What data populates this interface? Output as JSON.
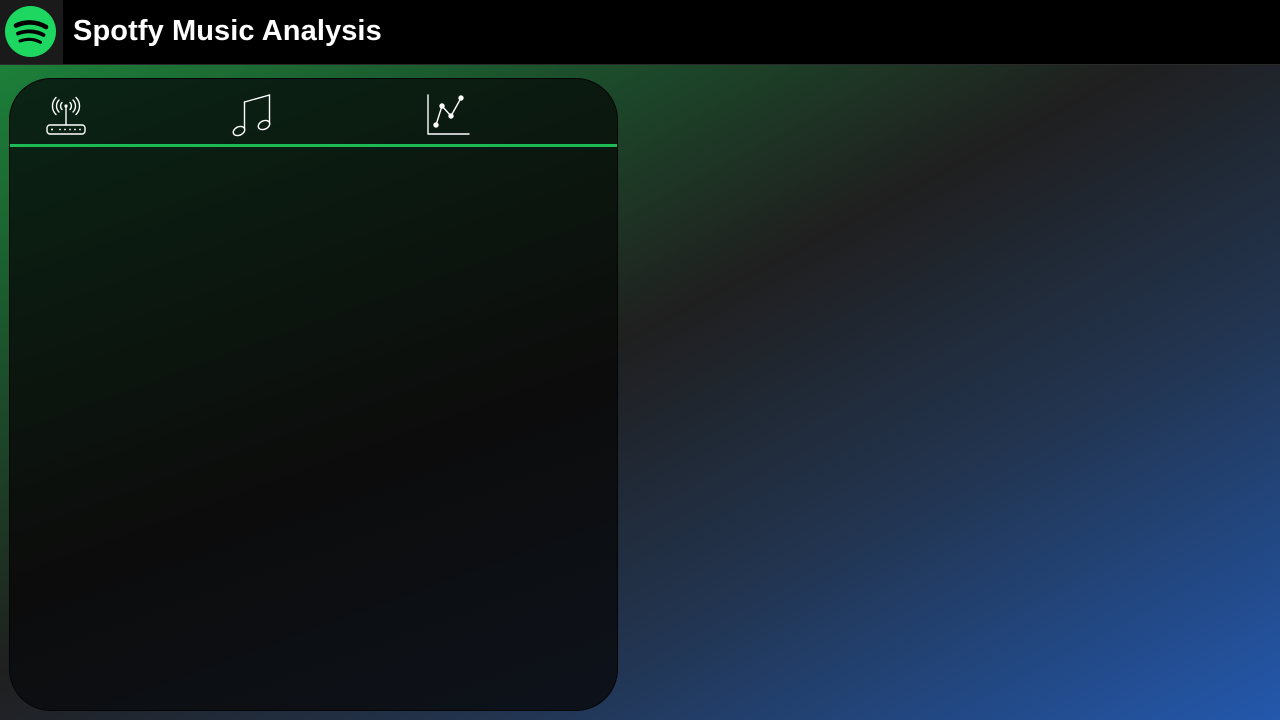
{
  "header": {
    "title": "Spotfy Music Analysis",
    "logo_icon": "spotify-logo-icon",
    "brand_color": "#1ED760"
  },
  "panel": {
    "nav_icons": [
      {
        "name": "router-icon"
      },
      {
        "name": "music-note-icon"
      },
      {
        "name": "line-chart-icon"
      }
    ],
    "divider_color": "#1DB954"
  }
}
